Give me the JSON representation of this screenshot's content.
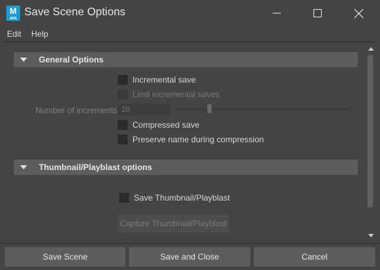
{
  "window": {
    "title": "Save Scene Options",
    "app_icon_letter": "M",
    "app_icon_sub": "APA",
    "app_icon_color": "#1b9bd1"
  },
  "menu": {
    "items": [
      "Edit",
      "Help"
    ]
  },
  "general_options": {
    "header": "General Options",
    "incremental_save": "Incremental save",
    "limit_incremental_saves": "Limit incremental saves",
    "number_of_increments_label": "Number of increments:",
    "number_of_increments_value": "20",
    "compressed_save": "Compressed save",
    "preserve_name": "Preserve name during compression"
  },
  "thumbnail_options": {
    "header": "Thumbnail/Playblast options",
    "save_thumbnail": "Save Thumbnail/Playblast",
    "capture_button": "Capture Thumbnail/Playblast"
  },
  "footer": {
    "save_scene": "Save Scene",
    "save_and_close": "Save and Close",
    "cancel": "Cancel"
  }
}
